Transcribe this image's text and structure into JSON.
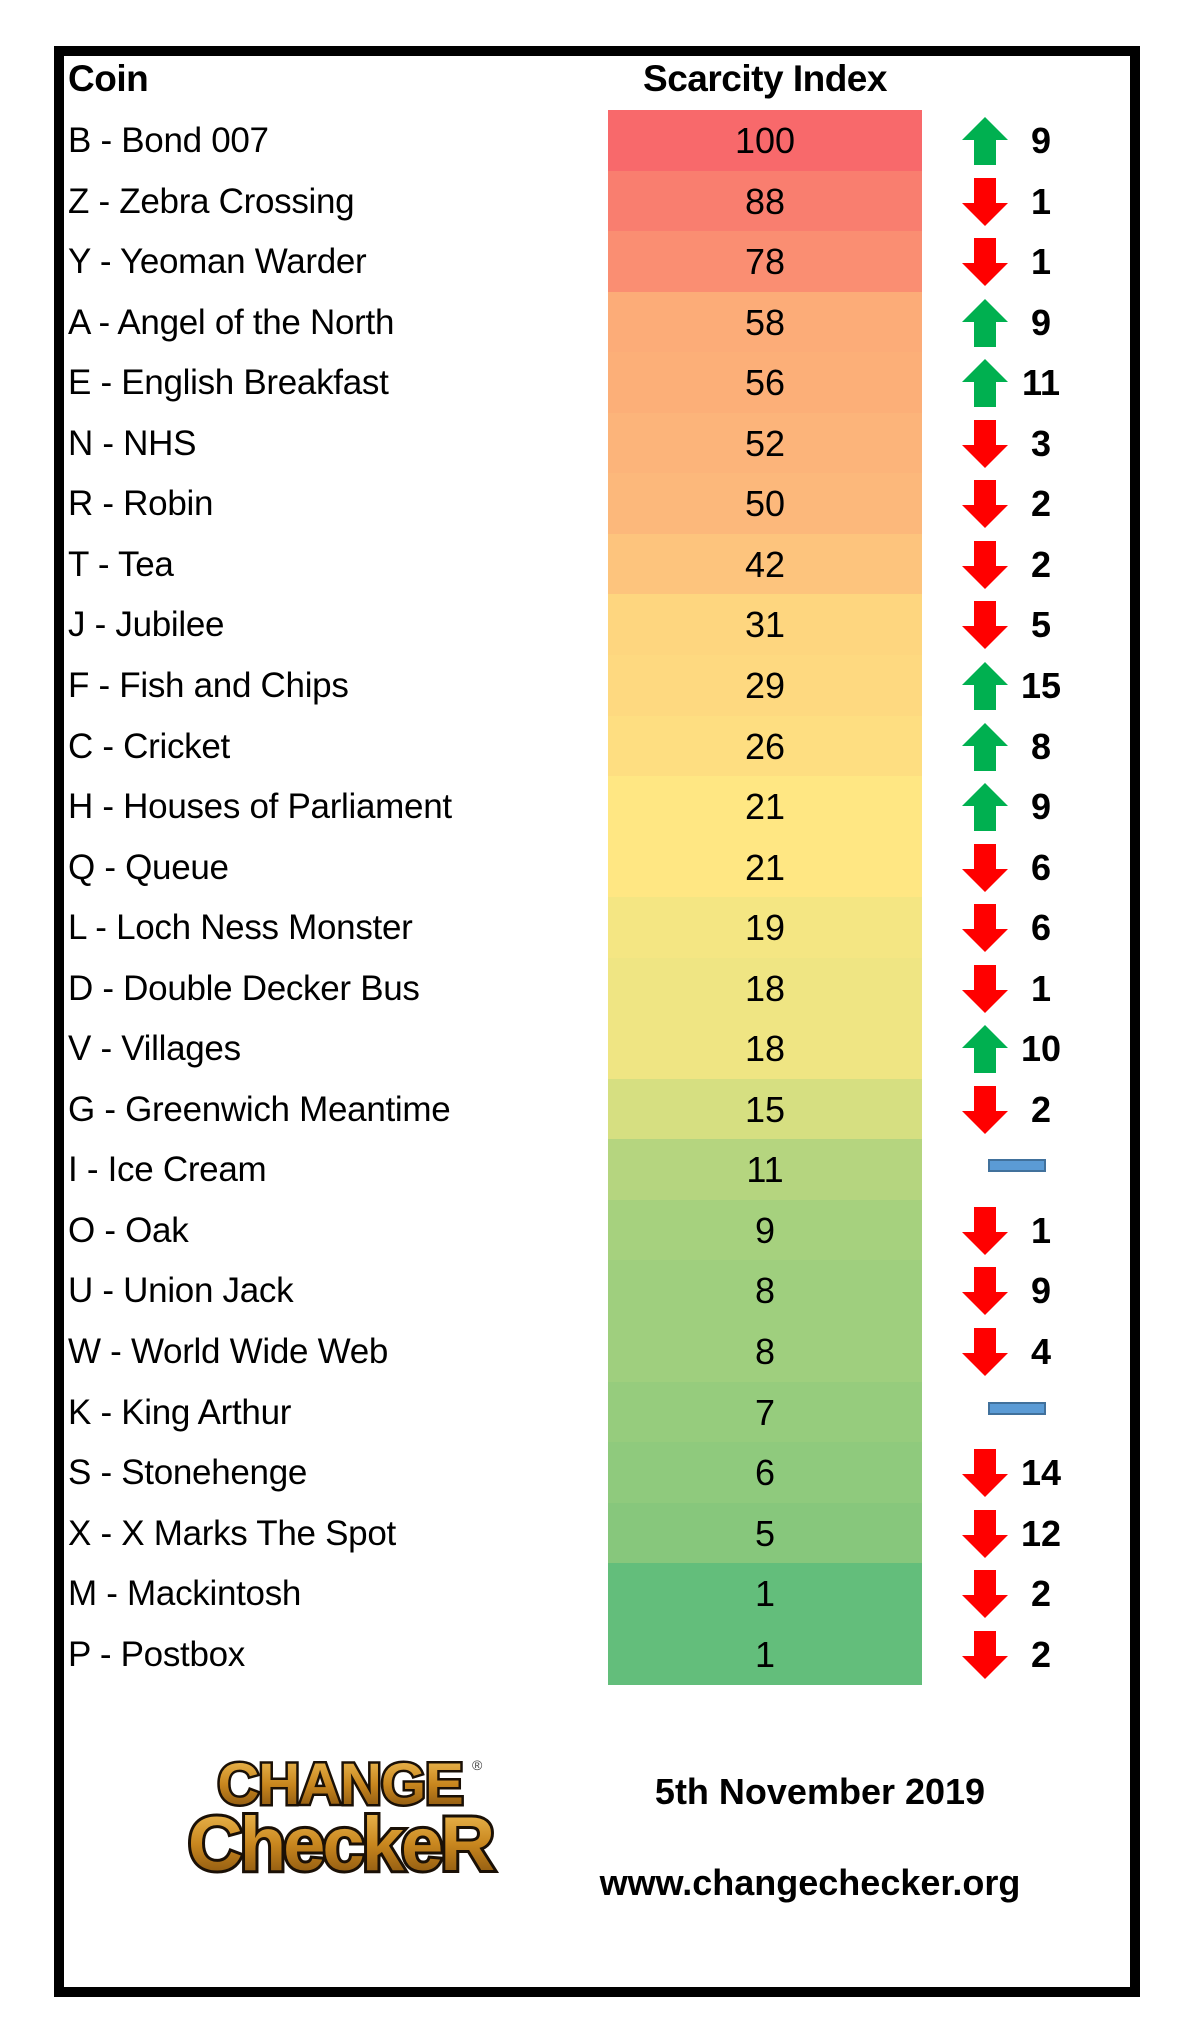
{
  "header": {
    "coin_label": "Coin",
    "scarcity_label": "Scarcity Index"
  },
  "rows": [
    {
      "coin": "B - Bond 007",
      "index": "100",
      "trend": "up",
      "change": "9",
      "color": "#f8696b"
    },
    {
      "coin": "Z - Zebra Crossing",
      "index": "88",
      "trend": "down",
      "change": "1",
      "color": "#f97e6f"
    },
    {
      "coin": "Y - Yeoman Warder",
      "index": "78",
      "trend": "down",
      "change": "1",
      "color": "#fa8e72"
    },
    {
      "coin": "A - Angel of the North",
      "index": "58",
      "trend": "up",
      "change": "9",
      "color": "#fcac78"
    },
    {
      "coin": "E - English Breakfast",
      "index": "56",
      "trend": "up",
      "change": "11",
      "color": "#fcaf78"
    },
    {
      "coin": "N - NHS",
      "index": "52",
      "trend": "down",
      "change": "3",
      "color": "#fcb47a"
    },
    {
      "coin": "R - Robin",
      "index": "50",
      "trend": "down",
      "change": "2",
      "color": "#fcb87b"
    },
    {
      "coin": "T - Tea",
      "index": "42",
      "trend": "down",
      "change": "2",
      "color": "#fdc47d"
    },
    {
      "coin": "J - Jubilee",
      "index": "31",
      "trend": "down",
      "change": "5",
      "color": "#fed67f"
    },
    {
      "coin": "F - Fish and Chips",
      "index": "29",
      "trend": "up",
      "change": "15",
      "color": "#fed980"
    },
    {
      "coin": "C - Cricket",
      "index": "26",
      "trend": "up",
      "change": "8",
      "color": "#fede81"
    },
    {
      "coin": "H - Houses of Parliament",
      "index": "21",
      "trend": "up",
      "change": "9",
      "color": "#ffe783"
    },
    {
      "coin": "Q - Queue",
      "index": "21",
      "trend": "down",
      "change": "6",
      "color": "#ffe783"
    },
    {
      "coin": "L - Loch Ness Monster",
      "index": "19",
      "trend": "down",
      "change": "6",
      "color": "#f4e683"
    },
    {
      "coin": "D - Double Decker Bus",
      "index": "18",
      "trend": "down",
      "change": "1",
      "color": "#efe583"
    },
    {
      "coin": "V - Villages",
      "index": "18",
      "trend": "up",
      "change": "10",
      "color": "#efe583"
    },
    {
      "coin": "G - Greenwich Meantime",
      "index": "15",
      "trend": "down",
      "change": "2",
      "color": "#d6df81"
    },
    {
      "coin": "I - Ice Cream",
      "index": "11",
      "trend": "same",
      "change": "",
      "color": "#b5d57f"
    },
    {
      "coin": "O - Oak",
      "index": "9",
      "trend": "down",
      "change": "1",
      "color": "#a6d17e"
    },
    {
      "coin": "U - Union Jack",
      "index": "8",
      "trend": "down",
      "change": "9",
      "color": "#9fcf7e"
    },
    {
      "coin": "W - World Wide Web",
      "index": "8",
      "trend": "down",
      "change": "4",
      "color": "#9fcf7e"
    },
    {
      "coin": "K - King Arthur",
      "index": "7",
      "trend": "same",
      "change": "",
      "color": "#96cc7d"
    },
    {
      "coin": "S - Stonehenge",
      "index": "6",
      "trend": "down",
      "change": "14",
      "color": "#8fca7d"
    },
    {
      "coin": "X - X Marks The Spot",
      "index": "5",
      "trend": "down",
      "change": "12",
      "color": "#87c77c"
    },
    {
      "coin": "M - Mackintosh",
      "index": "1",
      "trend": "down",
      "change": "2",
      "color": "#63be7b"
    },
    {
      "coin": "P - Postbox",
      "index": "1",
      "trend": "down",
      "change": "2",
      "color": "#63be7b"
    }
  ],
  "colors": {
    "up_arrow": "#00b050",
    "down_arrow": "#ff0000",
    "same_fill": "#5b9bd5",
    "same_border": "#41719c"
  },
  "footer": {
    "logo_line1": "CHANGE",
    "logo_line2": "CheckeR",
    "logo_registered": "®",
    "date": "5th November 2019",
    "url": "www.changechecker.org"
  }
}
